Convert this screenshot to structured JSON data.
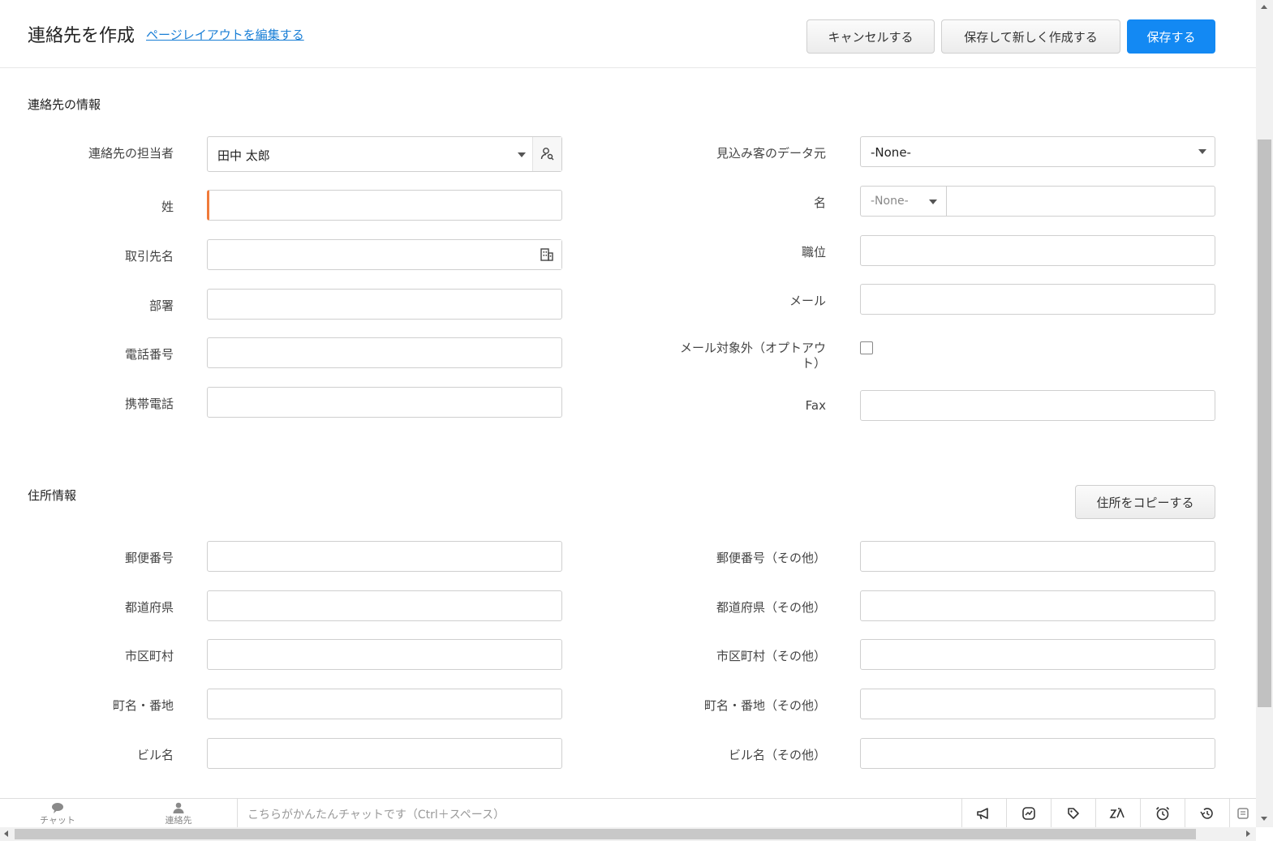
{
  "header": {
    "title": "連絡先を作成",
    "edit_layout_link": "ページレイアウトを編集する",
    "cancel_label": "キャンセルする",
    "save_new_label": "保存して新しく作成する",
    "save_label": "保存する"
  },
  "contact_section": {
    "title": "連絡先の情報",
    "owner_label": "連絡先の担当者",
    "owner_value": "田中 太郎",
    "last_name_label": "姓",
    "account_label": "取引先名",
    "department_label": "部署",
    "phone_label": "電話番号",
    "mobile_label": "携帯電話",
    "lead_source_label": "見込み客のデータ元",
    "lead_source_value": "-None-",
    "first_name_label": "名",
    "salutation_value": "-None-",
    "title_label": "職位",
    "email_label": "メール",
    "email_optout_label_line1": "メール対象外（オプトアウ",
    "email_optout_label_line2": "ト）",
    "fax_label": "Fax"
  },
  "address_section": {
    "title": "住所情報",
    "copy_button": "住所をコピーする",
    "zip_label": "郵便番号",
    "prefecture_label": "都道府県",
    "city_label": "市区町村",
    "street_label": "町名・番地",
    "building_label": "ビル名",
    "other_zip_label": "郵便番号（その他）",
    "other_prefecture_label": "都道府県（その他）",
    "other_city_label": "市区町村（その他）",
    "other_street_label": "町名・番地（その他）",
    "other_building_label": "ビル名（その他）"
  },
  "bottom_bar": {
    "chat_label": "チャット",
    "contacts_label": "連絡先",
    "chat_placeholder": "こちらがかんたんチャットです（Ctrl＋スペース）",
    "icons": [
      "megaphone-icon",
      "chart-icon",
      "tag-icon",
      "zia-icon",
      "alarm-icon",
      "history-icon",
      "notes-icon"
    ]
  },
  "colors": {
    "primary": "#1389f3",
    "mandatory": "#f07a3a",
    "link": "#1a7fd6"
  }
}
